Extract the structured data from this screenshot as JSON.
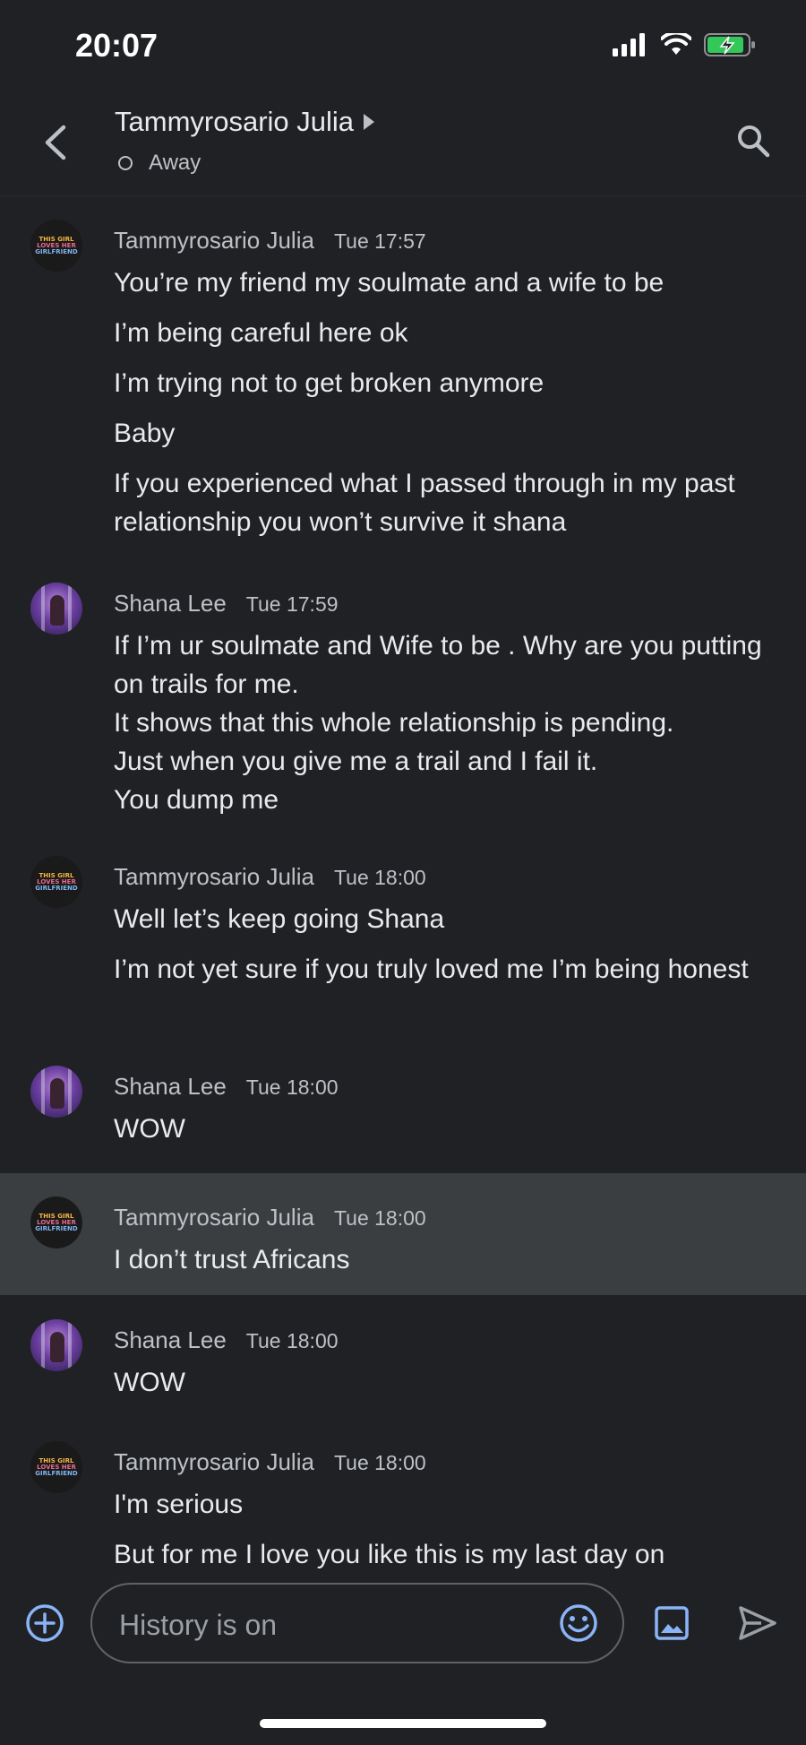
{
  "status_bar": {
    "time": "20:07"
  },
  "header": {
    "title": "Tammyrosario Julia",
    "presence": "Away"
  },
  "avatars": {
    "tammy_logo": [
      "THIS GIRL",
      "LOVES HER",
      "GIRLFRIEND"
    ]
  },
  "messages": [
    {
      "sender": "Tammyrosario Julia",
      "time": "Tue 17:57",
      "avatar": "logo",
      "lines": [
        "You’re my friend my soulmate and a wife to be",
        "I’m being careful here ok",
        "I’m trying not to get broken anymore",
        "Baby",
        "If you experienced what I passed through in my past relationship you won’t survive it shana"
      ]
    },
    {
      "sender": "Shana Lee",
      "time": "Tue 17:59",
      "avatar": "photo",
      "lines": [
        "If I’m ur soulmate and Wife to be . Why are you putting on trails for me.",
        "It shows that this whole relationship is pending.",
        "Just when you give me a trail and I fail it.",
        "You dump me"
      ]
    },
    {
      "sender": "Tammyrosario Julia",
      "time": "Tue 18:00",
      "avatar": "logo",
      "lines": [
        "Well let’s keep going Shana",
        "I’m not yet sure if you truly loved me I’m being honest"
      ]
    },
    {
      "sender": "Shana Lee",
      "time": "Tue 18:00",
      "avatar": "photo",
      "lines": [
        "WOW"
      ]
    },
    {
      "sender": "Tammyrosario Julia",
      "time": "Tue 18:00",
      "avatar": "logo",
      "lines": [
        "I don’t trust Africans"
      ]
    },
    {
      "sender": "Shana Lee",
      "time": "Tue 18:00",
      "avatar": "photo",
      "lines": [
        "WOW"
      ]
    },
    {
      "sender": "Tammyrosario Julia",
      "time": "Tue 18:00",
      "avatar": "logo",
      "lines": [
        "I'm serious",
        "But for me I love you like this is my last day on"
      ]
    }
  ],
  "composer": {
    "placeholder": "History is on"
  },
  "colors": {
    "background": "#202124",
    "highlight_row": "#3b3e40",
    "accent_blue": "#8ab4f8",
    "battery_green": "#34c759"
  },
  "icons": [
    "chevron-left-icon",
    "play-arrow-icon",
    "search-icon",
    "add-circle-icon",
    "emoji-icon",
    "image-icon",
    "send-icon",
    "signal-icon",
    "wifi-icon",
    "battery-icon"
  ]
}
